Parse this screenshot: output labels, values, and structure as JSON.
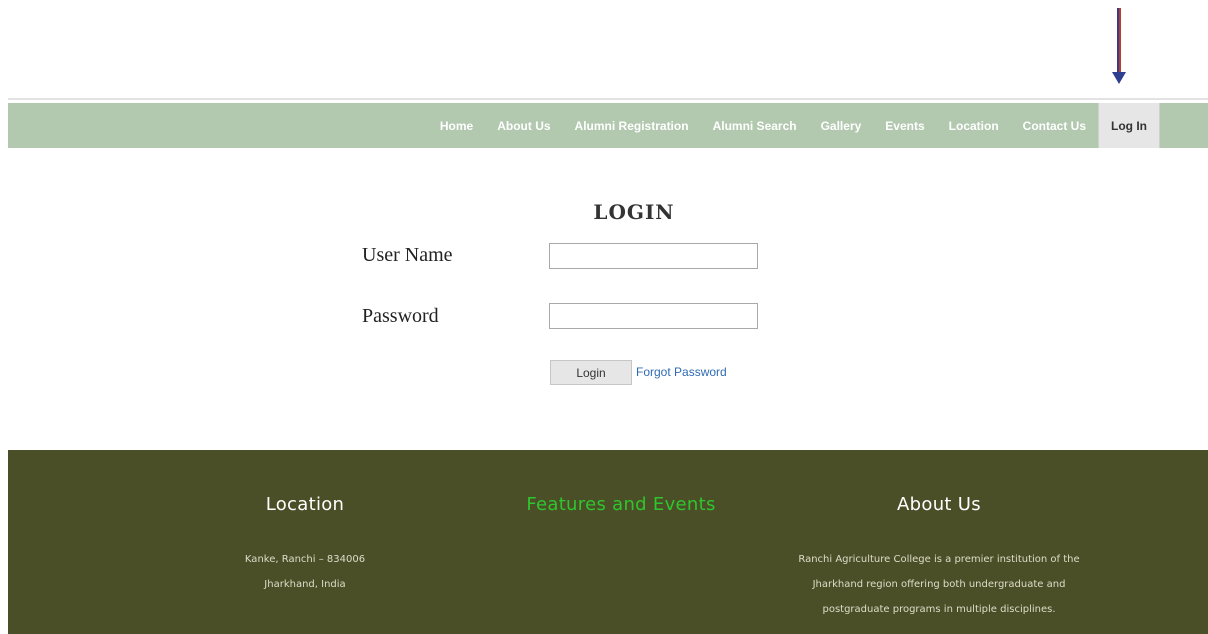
{
  "nav": {
    "items": [
      {
        "label": "Home"
      },
      {
        "label": "About Us"
      },
      {
        "label": "Alumni Registration"
      },
      {
        "label": "Alumni Search"
      },
      {
        "label": "Gallery"
      },
      {
        "label": "Events"
      },
      {
        "label": "Location"
      },
      {
        "label": "Contact Us"
      },
      {
        "label": "Log In",
        "active": true
      }
    ]
  },
  "login": {
    "title": "LOGIN",
    "username_label": "User Name",
    "username_value": "",
    "password_label": "Password",
    "password_value": "",
    "submit_label": "Login",
    "forgot_label": "Forgot Password"
  },
  "footer": {
    "location": {
      "heading": "Location",
      "lines": [
        "Kanke, Ranchi – 834006",
        "Jharkhand, India"
      ]
    },
    "features": {
      "heading": "Features and Events"
    },
    "about": {
      "heading": "About Us",
      "lines": [
        "Ranchi Agriculture College is a premier institution of the",
        "Jharkhand region offering both undergraduate and",
        "postgraduate programs in multiple disciplines."
      ]
    }
  },
  "colors": {
    "nav_bg": "#b2c9b0",
    "footer_bg": "#4b4f27",
    "features_heading": "#2ec52e",
    "link": "#2f6bb3"
  },
  "icons": {
    "annotation_arrow": "down-arrow-icon"
  }
}
